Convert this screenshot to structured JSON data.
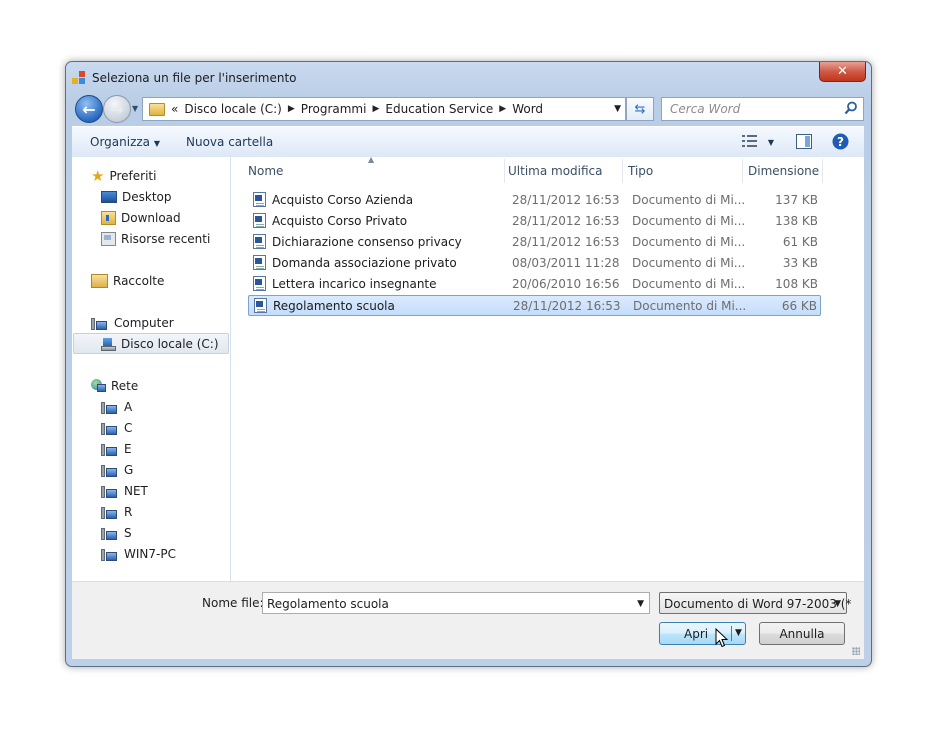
{
  "window": {
    "title": "Seleziona un file per l'inserimento",
    "close_glyph": "✕"
  },
  "address": {
    "overflow": "«",
    "crumbs": [
      "Disco locale (C:)",
      "Programmi",
      "Education Service",
      "Word"
    ],
    "search_placeholder": "Cerca Word"
  },
  "toolbar": {
    "organize_label": "Organizza",
    "new_folder_label": "Nuova cartella"
  },
  "nav": {
    "favorites": {
      "label": "Preferiti",
      "items": [
        "Desktop",
        "Download",
        "Risorse recenti"
      ]
    },
    "libraries": {
      "label": "Raccolte"
    },
    "computer": {
      "label": "Computer",
      "items": [
        "Disco locale (C:)"
      ]
    },
    "network": {
      "label": "Rete",
      "items": [
        "A",
        "C",
        "E",
        "G",
        "NET",
        "R",
        "S",
        "WIN7-PC"
      ]
    }
  },
  "columns": {
    "name": "Nome",
    "modified": "Ultima modifica",
    "type": "Tipo",
    "size": "Dimensione"
  },
  "files": [
    {
      "name": "Acquisto Corso Azienda",
      "modified": "28/11/2012 16:53",
      "type": "Documento di Mi...",
      "size": "137 KB"
    },
    {
      "name": "Acquisto Corso Privato",
      "modified": "28/11/2012 16:53",
      "type": "Documento di Mi...",
      "size": "138 KB"
    },
    {
      "name": "Dichiarazione consenso privacy",
      "modified": "28/11/2012 16:53",
      "type": "Documento di Mi...",
      "size": "61 KB"
    },
    {
      "name": "Domanda associazione privato",
      "modified": "08/03/2011 11:28",
      "type": "Documento di Mi...",
      "size": "33 KB"
    },
    {
      "name": "Lettera incarico insegnante",
      "modified": "20/06/2010 16:56",
      "type": "Documento di Mi...",
      "size": "108 KB"
    },
    {
      "name": "Regolamento scuola",
      "modified": "28/11/2012 16:53",
      "type": "Documento di Mi...",
      "size": "66 KB",
      "selected": true
    }
  ],
  "footer": {
    "filename_label": "Nome file:",
    "filename_value": "Regolamento scuola",
    "filter_value": "Documento di Word 97-2003 (*",
    "open_label": "Apri",
    "cancel_label": "Annulla"
  },
  "colors": {
    "accent": "#2a69c1",
    "selection": "#c4ddfc",
    "selection_border": "#7da2ce"
  }
}
